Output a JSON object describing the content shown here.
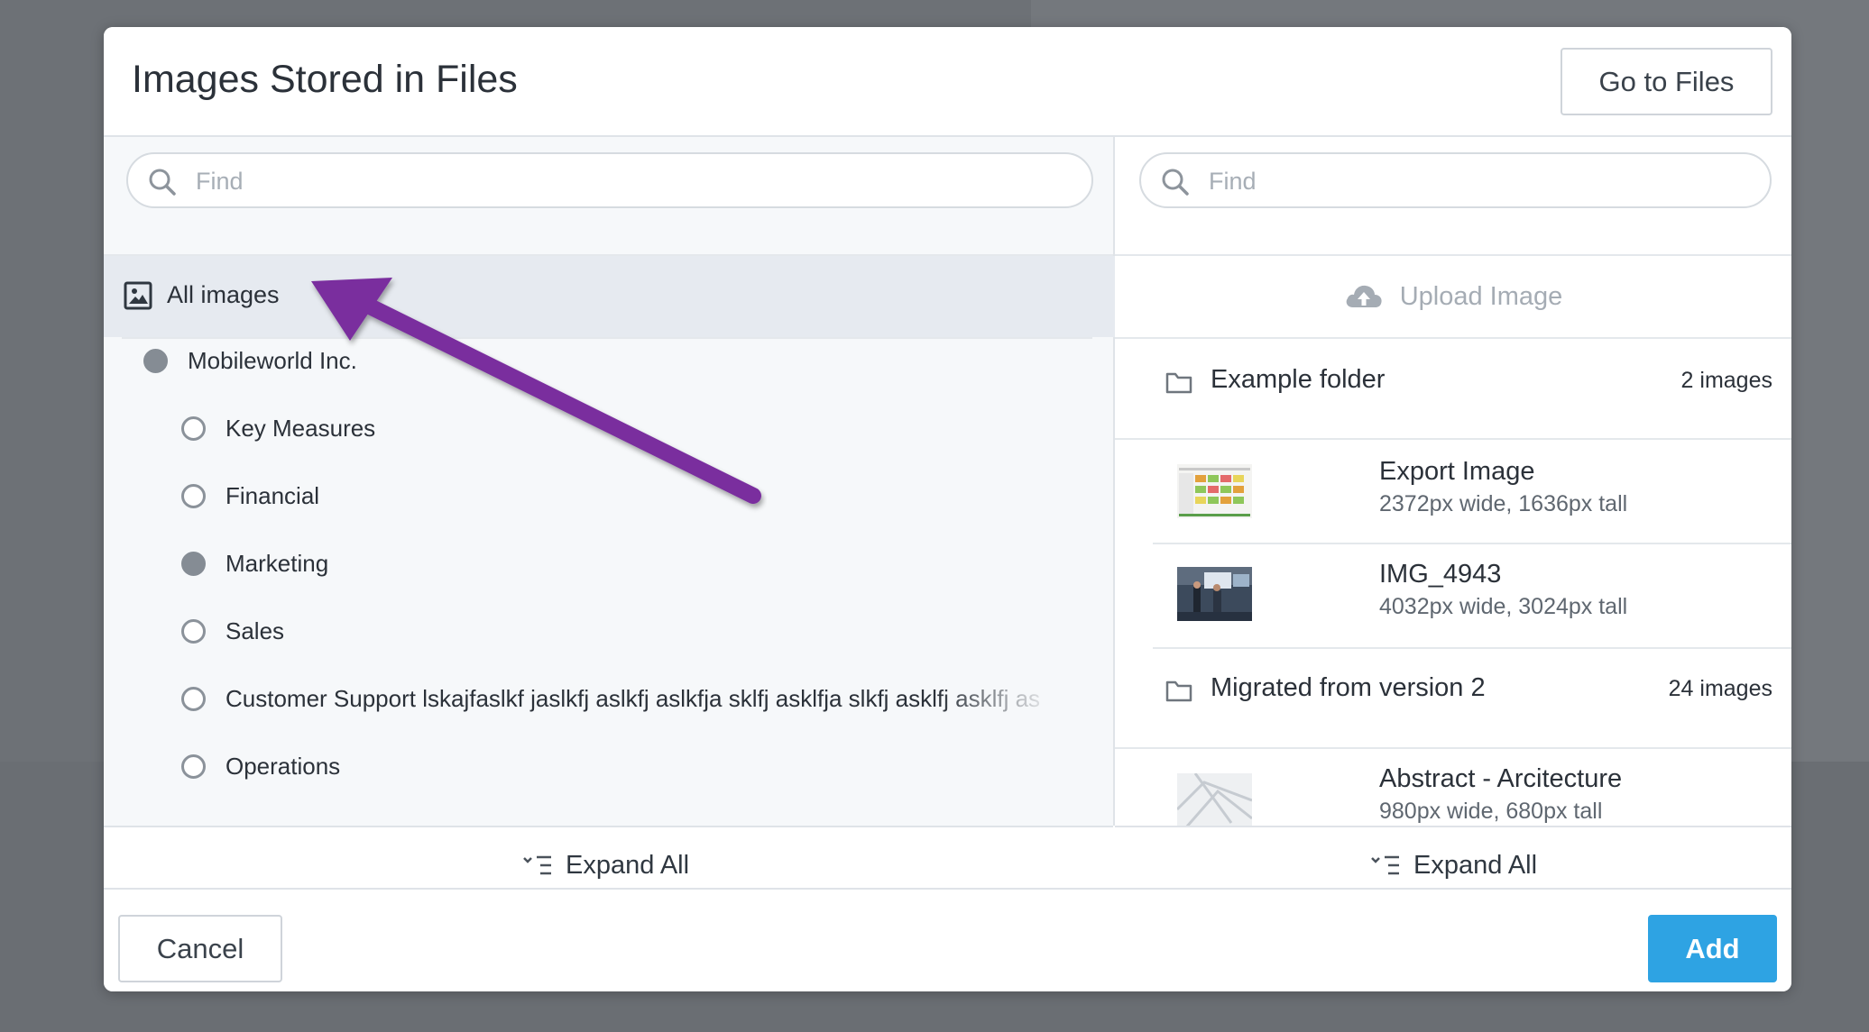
{
  "modal": {
    "title": "Images Stored in Files",
    "go_to_files_label": "Go to Files"
  },
  "left": {
    "search_placeholder": "Find",
    "all_images_label": "All images",
    "tree": [
      {
        "label": "Mobileworld Inc.",
        "selected": true
      },
      {
        "label": "Key Measures",
        "selected": false
      },
      {
        "label": "Financial",
        "selected": false
      },
      {
        "label": "Marketing",
        "selected": true
      },
      {
        "label": "Sales",
        "selected": false
      },
      {
        "label": "Customer Support lskajfaslkf jaslkfj aslkfj aslkfja sklfj asklfja slkfj asklfj asklfj as",
        "selected": false
      },
      {
        "label": "Operations",
        "selected": false
      }
    ],
    "expand_all_label": "Expand All"
  },
  "right": {
    "search_placeholder": "Find",
    "upload_label": "Upload Image",
    "folders": [
      {
        "name": "Example folder",
        "count": "2 images"
      },
      {
        "name": "Migrated from version 2",
        "count": "24 images"
      }
    ],
    "images": [
      {
        "name": "Export Image",
        "meta": "2372px wide, 1636px tall"
      },
      {
        "name": "IMG_4943",
        "meta": "4032px wide, 3024px tall"
      },
      {
        "name": "Abstract - Arcitecture",
        "meta": "980px wide, 680px tall"
      }
    ],
    "expand_all_label": "Expand All"
  },
  "footer": {
    "cancel_label": "Cancel",
    "add_label": "Add"
  },
  "colors": {
    "accent": "#2ea3e3",
    "annotation_arrow": "#7a2f9e",
    "overlay": "#6d7176"
  },
  "icons": [
    "search-icon",
    "image-icon",
    "upload-cloud-icon",
    "folder-icon",
    "expand-all-icon",
    "annotation-arrow"
  ]
}
